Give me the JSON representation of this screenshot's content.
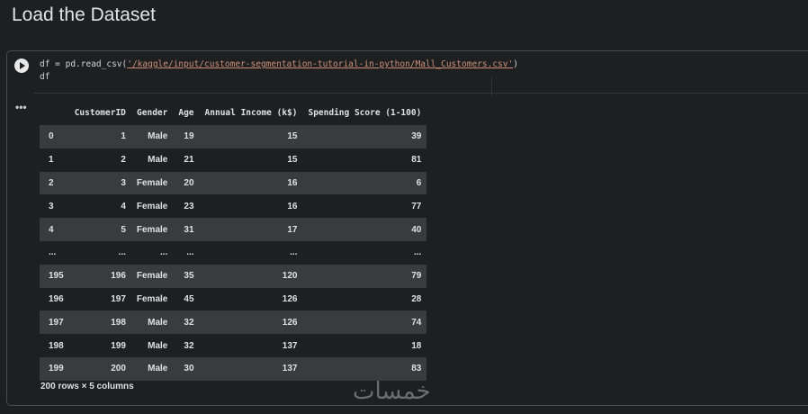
{
  "heading": "Load the Dataset",
  "code": {
    "line1_prefix": "df = pd.read_csv(",
    "line1_string": "'/kaggle/input/customer-segmentation-tutorial-in-python/Mall_Customers.csv'",
    "line1_suffix": ")",
    "line2": "df"
  },
  "output_menu_icon": "ellipsis-icon",
  "output_menu_glyph": "•••",
  "table": {
    "columns": [
      "",
      "CustomerID",
      "Gender",
      "Age",
      "Annual Income (k$)",
      "Spending Score (1-100)"
    ],
    "rows": [
      [
        "0",
        "1",
        "Male",
        "19",
        "15",
        "39"
      ],
      [
        "1",
        "2",
        "Male",
        "21",
        "15",
        "81"
      ],
      [
        "2",
        "3",
        "Female",
        "20",
        "16",
        "6"
      ],
      [
        "3",
        "4",
        "Female",
        "23",
        "16",
        "77"
      ],
      [
        "4",
        "5",
        "Female",
        "31",
        "17",
        "40"
      ],
      [
        "...",
        "...",
        "...",
        "...",
        "...",
        "..."
      ],
      [
        "195",
        "196",
        "Female",
        "35",
        "120",
        "79"
      ],
      [
        "196",
        "197",
        "Female",
        "45",
        "126",
        "28"
      ],
      [
        "197",
        "198",
        "Male",
        "32",
        "126",
        "74"
      ],
      [
        "198",
        "199",
        "Male",
        "32",
        "137",
        "18"
      ],
      [
        "199",
        "200",
        "Male",
        "30",
        "137",
        "83"
      ]
    ]
  },
  "caption": "200 rows × 5 columns",
  "watermark": "خمسات"
}
